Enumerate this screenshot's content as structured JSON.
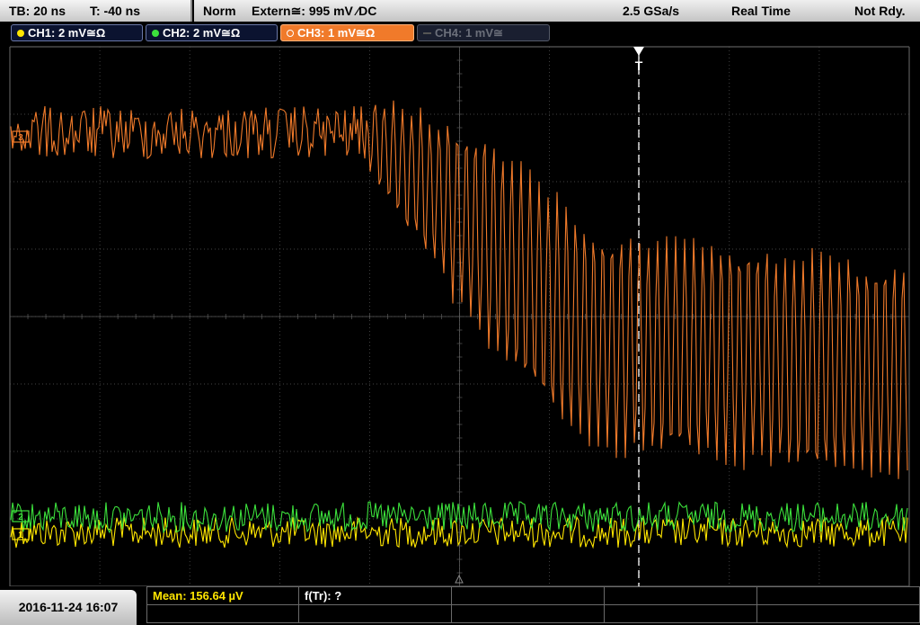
{
  "topbar": {
    "timebase": "TB: 20 ns",
    "trigger_time": "T: -40 ns",
    "mode": "Norm",
    "trigger_source": "Extern≅: 995 mV ⁄DC",
    "sample_rate": "2.5 GSa/s",
    "acq_mode": "Real Time",
    "status": "Not Rdy."
  },
  "channels": [
    {
      "label": "CH1: 2 mV≅Ω",
      "color": "#ffe600",
      "active": true
    },
    {
      "label": "CH2: 2 mV≅Ω",
      "color": "#3ce13c",
      "active": true
    },
    {
      "label": "CH3: 1 mV≅Ω",
      "color": "#f07a2a",
      "active": true
    },
    {
      "label": "CH4: 1 mV≅",
      "color": "#555a68",
      "active": false
    }
  ],
  "markers": {
    "trigger_marker": "T",
    "ch1_marker": "1",
    "ch2_marker": "2",
    "ch3_marker": "3"
  },
  "footer": {
    "datetime": "2016-11-24 16:07",
    "measurement_mean": "Mean: 156.64 µV",
    "measurement_tr": "f(Tr): ?"
  },
  "colors": {
    "ch1": "#ffe600",
    "ch2": "#3ce13c",
    "ch3": "#f07a2a",
    "grid": "#5a5a5a"
  }
}
